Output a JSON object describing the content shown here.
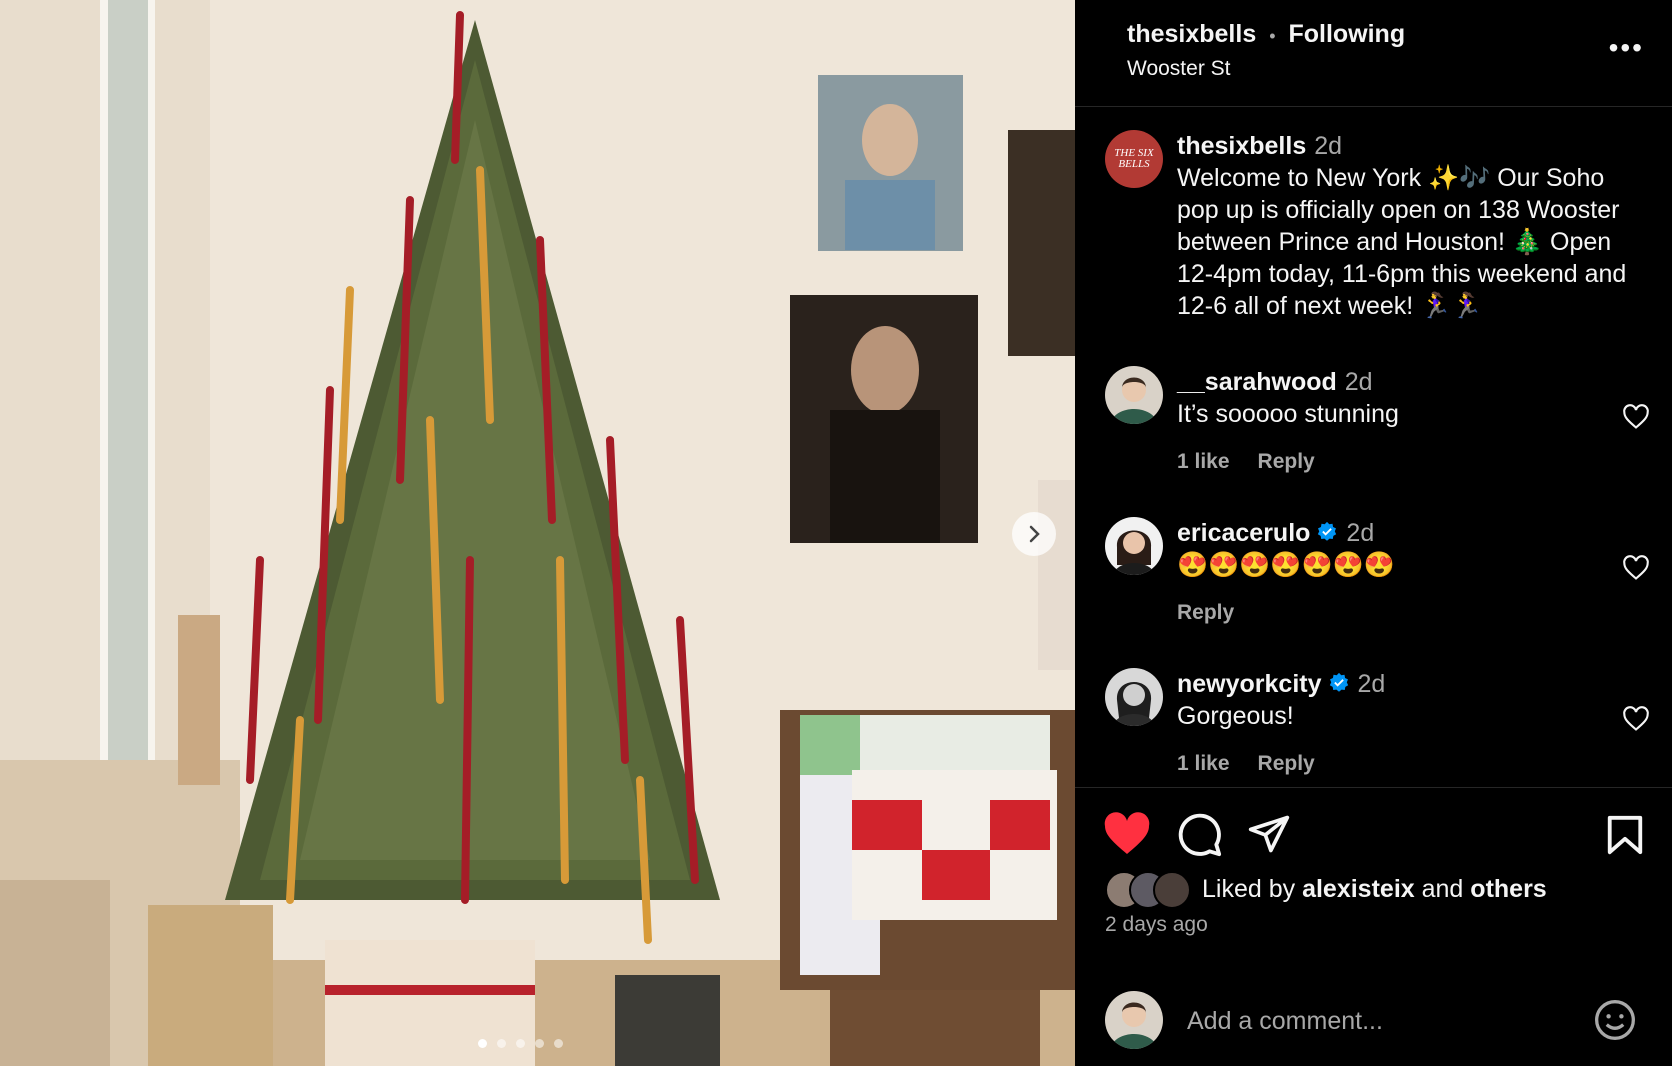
{
  "post_header": {
    "username": "thesixbells",
    "separator": "•",
    "follow_state": "Following",
    "location": "Wooster St",
    "more_label": "•••"
  },
  "caption": {
    "username": "thesixbells",
    "time": "2d",
    "text": "Welcome to New York ✨🎶 Our Soho pop up is officially open on 138 Wooster between Prince and Houston! 🎄 Open 12-4pm today, 11-6pm this weekend and 12-6 all of next week! 🏃‍♀️🏃‍♀️",
    "avatar_text": "THE SIX BELLS"
  },
  "comments": [
    {
      "username": "__sarahwood",
      "time": "2d",
      "verified": false,
      "text": "It’s sooooo stunning",
      "likes": "1 like",
      "reply": "Reply"
    },
    {
      "username": "ericacerulo",
      "time": "2d",
      "verified": true,
      "text": "😍😍😍😍😍😍😍",
      "likes": "",
      "reply": "Reply"
    },
    {
      "username": "newyorkcity",
      "time": "2d",
      "verified": true,
      "text": "Gorgeous!",
      "likes": "1 like",
      "reply": "Reply"
    }
  ],
  "likes": {
    "prefix": "Liked by",
    "user": "alexisteix",
    "and": "and",
    "others": "others"
  },
  "timestamp": "2 days ago",
  "comment_input": {
    "placeholder": "Add a comment..."
  },
  "carousel": {
    "total": 5,
    "current": 1
  },
  "colors": {
    "background": "#000000",
    "like_red": "#ff3040",
    "verified_blue": "#0095f6",
    "muted_text": "#a8a8a8",
    "avatar_brand": "#b23a34"
  }
}
